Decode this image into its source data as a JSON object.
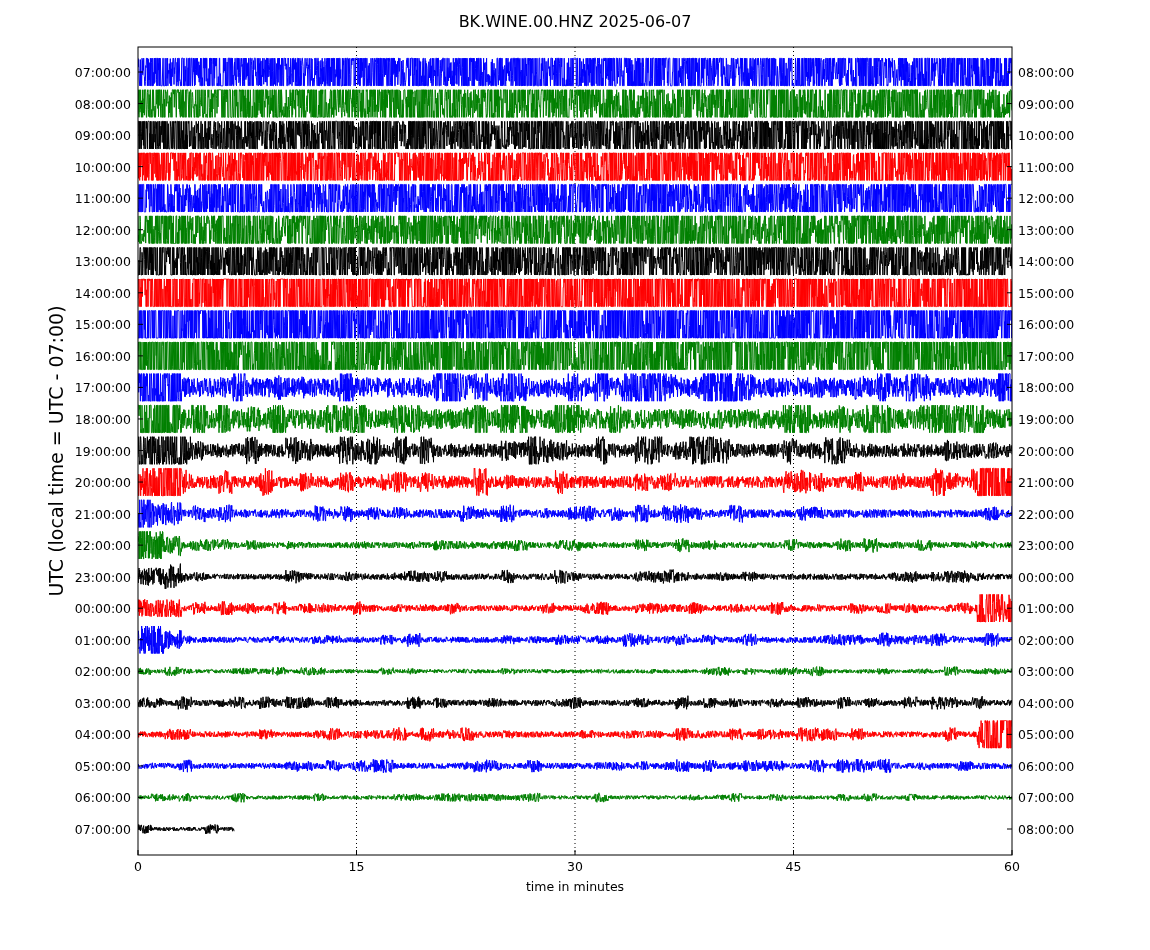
{
  "title": "BK.WINE.00.HNZ 2025-06-07",
  "y_axis_label": "UTC (local time = UTC - 07:00)",
  "x_axis_label": "time in minutes",
  "x_ticks": [
    "0",
    "15",
    "30",
    "45",
    "60"
  ],
  "rows": [
    {
      "utc": "07:00:00",
      "local": "08:00:00",
      "color": "#0000ff"
    },
    {
      "utc": "08:00:00",
      "local": "09:00:00",
      "color": "#008000"
    },
    {
      "utc": "09:00:00",
      "local": "10:00:00",
      "color": "#000000"
    },
    {
      "utc": "10:00:00",
      "local": "11:00:00",
      "color": "#ff0000"
    },
    {
      "utc": "11:00:00",
      "local": "12:00:00",
      "color": "#0000ff"
    },
    {
      "utc": "12:00:00",
      "local": "13:00:00",
      "color": "#008000"
    },
    {
      "utc": "13:00:00",
      "local": "14:00:00",
      "color": "#000000"
    },
    {
      "utc": "14:00:00",
      "local": "15:00:00",
      "color": "#ff0000"
    },
    {
      "utc": "15:00:00",
      "local": "16:00:00",
      "color": "#0000ff"
    },
    {
      "utc": "16:00:00",
      "local": "17:00:00",
      "color": "#008000"
    },
    {
      "utc": "17:00:00",
      "local": "18:00:00",
      "color": "#0000ff"
    },
    {
      "utc": "18:00:00",
      "local": "19:00:00",
      "color": "#008000"
    },
    {
      "utc": "19:00:00",
      "local": "20:00:00",
      "color": "#000000"
    },
    {
      "utc": "20:00:00",
      "local": "21:00:00",
      "color": "#ff0000"
    },
    {
      "utc": "21:00:00",
      "local": "22:00:00",
      "color": "#0000ff"
    },
    {
      "utc": "22:00:00",
      "local": "23:00:00",
      "color": "#008000"
    },
    {
      "utc": "23:00:00",
      "local": "00:00:00",
      "color": "#000000"
    },
    {
      "utc": "00:00:00",
      "local": "01:00:00",
      "color": "#ff0000"
    },
    {
      "utc": "01:00:00",
      "local": "02:00:00",
      "color": "#0000ff"
    },
    {
      "utc": "02:00:00",
      "local": "03:00:00",
      "color": "#008000"
    },
    {
      "utc": "03:00:00",
      "local": "04:00:00",
      "color": "#000000"
    },
    {
      "utc": "04:00:00",
      "local": "05:00:00",
      "color": "#ff0000"
    },
    {
      "utc": "05:00:00",
      "local": "06:00:00",
      "color": "#0000ff"
    },
    {
      "utc": "06:00:00",
      "local": "07:00:00",
      "color": "#008000"
    },
    {
      "utc": "07:00:00",
      "local": "08:00:00",
      "color": "#000000"
    }
  ]
}
